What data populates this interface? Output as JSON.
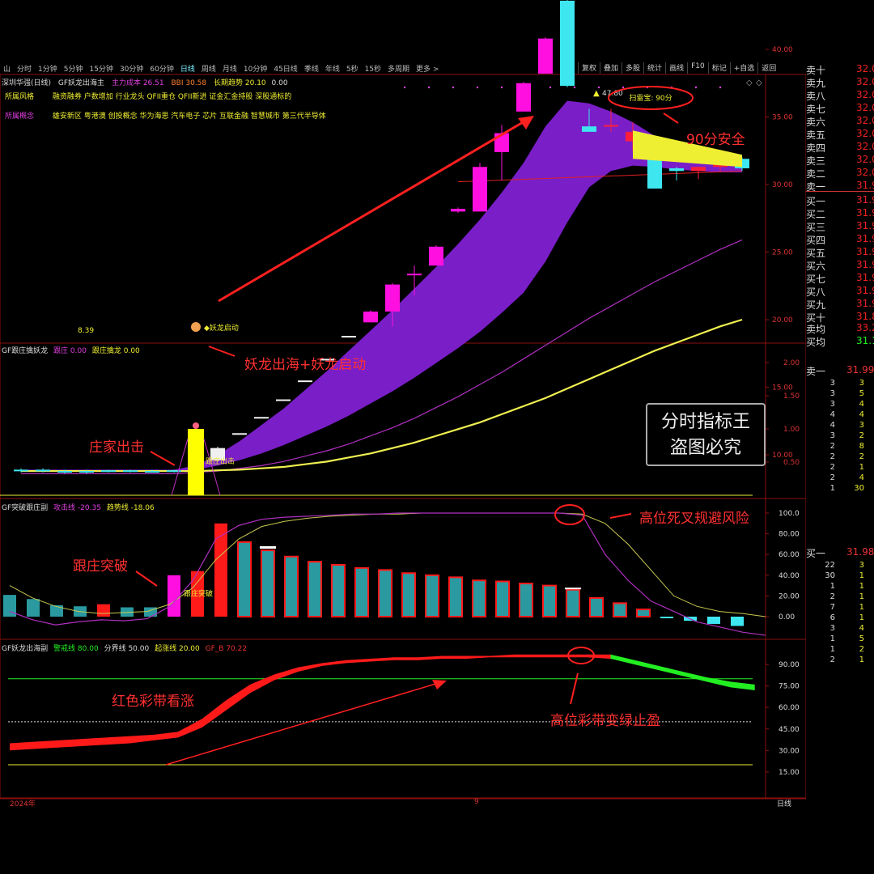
{
  "toolbar": {
    "items": [
      "山",
      "分时",
      "1分钟",
      "5分钟",
      "15分钟",
      "30分钟",
      "60分钟",
      "日线",
      "周线",
      "月线",
      "10分钟",
      "45日线",
      "季线",
      "年线",
      "5秒",
      "15秒",
      "多周期",
      "更多 >"
    ],
    "right_items": [
      "复权",
      "叠加",
      "多股",
      "统计",
      "画线",
      "F10",
      "标记",
      "+自选",
      "返回"
    ]
  },
  "main_header": {
    "stock": "深圳华强(日线)",
    "indicator": "GF妖龙出海主",
    "cost_label": "主力成本",
    "cost_value": "26.51",
    "bbi_label": "BBI",
    "bbi_value": "30.58",
    "trend_label": "长期趋势",
    "trend_value": "20.10",
    "extra_value": "0.00"
  },
  "info": {
    "style_label": "所属风格",
    "style_text": "融资融券 户数增加 行业龙头 QFII重仓 QFII新进 证金汇金持股 深股通标的",
    "concept_label": "所属概念",
    "concept_text": "雄安新区 粤港澳 创投概念 华为海思 汽车电子 芯片 互联金融 智慧城市 第三代半导体"
  },
  "main_chart": {
    "y_ticks": [
      "40.00",
      "35.00",
      "30.00",
      "25.00",
      "20.00",
      "15.00",
      "10.00"
    ],
    "y_values": [
      40,
      35,
      30,
      25,
      20,
      15,
      10
    ],
    "candles": [
      {
        "o": 8.8,
        "h": 9.0,
        "l": 8.7,
        "c": 8.9
      },
      {
        "o": 8.9,
        "h": 9.0,
        "l": 8.7,
        "c": 8.8
      },
      {
        "o": 8.8,
        "h": 8.9,
        "l": 8.6,
        "c": 8.75
      },
      {
        "o": 8.7,
        "h": 8.9,
        "l": 8.6,
        "c": 8.8
      },
      {
        "o": 8.8,
        "h": 8.9,
        "l": 8.7,
        "c": 8.85
      },
      {
        "o": 8.85,
        "h": 8.9,
        "l": 8.7,
        "c": 8.8
      },
      {
        "o": 8.8,
        "h": 8.9,
        "l": 8.7,
        "c": 8.75
      },
      {
        "o": 8.75,
        "h": 8.9,
        "l": 8.7,
        "c": 8.85
      },
      {
        "o": 8.6,
        "h": 10.0,
        "l": 8.4,
        "c": 9.6
      },
      {
        "o": 9.6,
        "h": 10.6,
        "l": 9.6,
        "c": 10.5
      },
      {
        "o": 11.6,
        "h": 11.6,
        "l": 11.6,
        "c": 11.6
      },
      {
        "o": 12.8,
        "h": 12.8,
        "l": 12.8,
        "c": 12.8
      },
      {
        "o": 14.1,
        "h": 14.1,
        "l": 14.1,
        "c": 14.1
      },
      {
        "o": 15.5,
        "h": 15.5,
        "l": 15.5,
        "c": 15.5
      },
      {
        "o": 17.1,
        "h": 17.1,
        "l": 17.1,
        "c": 17.1
      },
      {
        "o": 18.8,
        "h": 18.8,
        "l": 18.8,
        "c": 18.8
      },
      {
        "o": 19.8,
        "h": 20.7,
        "l": 19.8,
        "c": 20.6
      },
      {
        "o": 20.6,
        "h": 22.7,
        "l": 19.5,
        "c": 22.6
      },
      {
        "o": 23.4,
        "h": 24.0,
        "l": 21.8,
        "c": 23.4
      },
      {
        "o": 24.0,
        "h": 25.5,
        "l": 24.0,
        "c": 25.4
      },
      {
        "o": 28.0,
        "h": 28.3,
        "l": 27.9,
        "c": 28.2
      },
      {
        "o": 28.0,
        "h": 31.6,
        "l": 28.0,
        "c": 31.3
      },
      {
        "o": 32.4,
        "h": 34.4,
        "l": 30.3,
        "c": 33.8
      },
      {
        "o": 35.4,
        "h": 37.6,
        "l": 35.4,
        "c": 37.5
      },
      {
        "o": 38.2,
        "h": 40.9,
        "l": 38.2,
        "c": 40.8
      },
      {
        "o": 43.6,
        "h": 43.8,
        "l": 37.2,
        "c": 37.3
      },
      {
        "o": 34.3,
        "h": 35.6,
        "l": 33.9,
        "c": 33.9
      },
      {
        "o": 34.3,
        "h": 35.6,
        "l": 33.9,
        "c": 34.4
      },
      {
        "o": 33.2,
        "h": 34.6,
        "l": 32.5,
        "c": 33.9
      },
      {
        "o": 32.8,
        "h": 33.1,
        "l": 29.7,
        "c": 29.7
      },
      {
        "o": 31.2,
        "h": 31.3,
        "l": 30.3,
        "c": 31.0
      },
      {
        "o": 31.0,
        "h": 31.3,
        "l": 30.4,
        "c": 31.3
      },
      {
        "o": 31.3,
        "h": 32.0,
        "l": 31.0,
        "c": 31.6
      },
      {
        "o": 31.9,
        "h": 32.0,
        "l": 31.0,
        "c": 31.2
      }
    ],
    "band_upper": [
      8.9,
      8.9,
      8.9,
      8.9,
      8.9,
      8.9,
      8.9,
      8.9,
      9.2,
      10.0,
      11.0,
      12.2,
      13.4,
      14.8,
      16.2,
      17.7,
      19.2,
      20.7,
      22.3,
      23.9,
      25.6,
      27.4,
      29.4,
      31.6,
      34.3,
      36.2,
      36.0,
      35.4,
      34.6,
      33.6,
      32.9,
      32.3,
      31.9,
      31.6
    ],
    "band_lower": [
      8.8,
      8.8,
      8.8,
      8.8,
      8.8,
      8.8,
      8.8,
      8.8,
      8.9,
      9.2,
      9.6,
      10.1,
      10.7,
      11.4,
      12.1,
      12.9,
      13.8,
      14.7,
      15.7,
      16.8,
      17.9,
      19.1,
      20.5,
      22.0,
      24.3,
      27.2,
      29.8,
      31.0,
      31.4,
      31.3,
      31.1,
      31.0,
      30.9,
      30.9
    ],
    "ma_purple": [
      8.6,
      8.6,
      8.6,
      8.6,
      8.6,
      8.6,
      8.6,
      8.6,
      8.7,
      8.8,
      9.0,
      9.2,
      9.5,
      9.9,
      10.3,
      10.8,
      11.4,
      12.0,
      12.7,
      13.5,
      14.3,
      15.2,
      16.1,
      17.1,
      18.1,
      19.1,
      20.1,
      21.0,
      21.9,
      22.8,
      23.6,
      24.4,
      25.2,
      25.9
    ],
    "ma_yellow": [
      8.8,
      8.8,
      8.8,
      8.8,
      8.8,
      8.8,
      8.8,
      8.8,
      8.8,
      8.85,
      8.9,
      9.0,
      9.1,
      9.3,
      9.5,
      9.8,
      10.1,
      10.5,
      10.9,
      11.4,
      11.9,
      12.4,
      13.0,
      13.6,
      14.2,
      14.9,
      15.6,
      16.3,
      17.0,
      17.7,
      18.3,
      18.9,
      19.5,
      20.0
    ],
    "price_low": "8.39",
    "price_high": "47.80",
    "low_signal": "妖龙启动",
    "safety_badge": "扫雷宝: 90分"
  },
  "panel2": {
    "header_name": "GF跟庄擒妖龙",
    "l1": "跟庄",
    "v1": "0.00",
    "l2": "跟庄擒龙",
    "v2": "0.00",
    "y_ticks": [
      "2.00",
      "1.50",
      "1.00",
      "0.50"
    ],
    "y_values": [
      2.0,
      1.5,
      1.0,
      0.5
    ],
    "signal_index": 8,
    "signal_value": 1.0,
    "signal_text": "跟庄出击"
  },
  "panel3": {
    "header_name": "GF突破跟庄副",
    "l1": "攻击线",
    "v1": "-20.35",
    "l2": "趋势线",
    "v2": "-18.06",
    "y_ticks": [
      "100.0",
      "80.00",
      "60.00",
      "40.00",
      "20.00",
      "0.00"
    ],
    "y_values": [
      100,
      80,
      60,
      40,
      20,
      0
    ],
    "bars": [
      21,
      17,
      11,
      10,
      12,
      9,
      9,
      40,
      44,
      90,
      72,
      64,
      58,
      53,
      50,
      47,
      45,
      42,
      40,
      38,
      35,
      34,
      32,
      30,
      26,
      18,
      13,
      7,
      -1,
      -4,
      -7,
      -9
    ],
    "line_yellow": [
      30,
      18,
      10,
      5,
      3,
      4,
      5,
      12,
      28,
      55,
      75,
      87,
      92,
      95,
      97,
      98,
      99,
      99,
      100,
      100,
      100,
      100,
      100,
      100,
      100,
      99,
      90,
      70,
      45,
      20,
      10,
      5,
      3,
      0
    ],
    "line_purple": [
      5,
      -3,
      -8,
      -5,
      -3,
      -4,
      -2,
      10,
      35,
      75,
      88,
      94,
      96,
      97,
      98,
      99,
      99,
      100,
      100,
      100,
      100,
      100,
      100,
      100,
      100,
      98,
      60,
      35,
      15,
      5,
      -5,
      -10,
      -15,
      -18
    ],
    "signal_text": "跟庄突破"
  },
  "panel4": {
    "header_name": "GF妖龙出海副",
    "l1": "警戒线",
    "v1": "80.00",
    "l2": "分界线",
    "v2": "50.00",
    "l3": "起涨线",
    "v3": "20.00",
    "l4": "GF_B",
    "v4": "70.22",
    "y_ticks": [
      "90.00",
      "75.00",
      "60.00",
      "45.00",
      "30.00",
      "15.00"
    ],
    "y_values": [
      90,
      75,
      60,
      45,
      30,
      15
    ],
    "band_upper": [
      35,
      36,
      37,
      38,
      39,
      40,
      41,
      43,
      52,
      65,
      76,
      83,
      88,
      91,
      93,
      94,
      95,
      95,
      96,
      96,
      96,
      97,
      97,
      97,
      97,
      97,
      93,
      89,
      85,
      81,
      78,
      76
    ],
    "band_lower": [
      30,
      31,
      32,
      33,
      34,
      35,
      37,
      39,
      46,
      58,
      70,
      79,
      85,
      89,
      91,
      92,
      93,
      93,
      94,
      94,
      95,
      95,
      95,
      95,
      95,
      94,
      90,
      86,
      82,
      78,
      74,
      72
    ],
    "cross_line": [
      20,
      22,
      25,
      29,
      33,
      38,
      43,
      48,
      54,
      60,
      65,
      70,
      74,
      78,
      81,
      84,
      86
    ]
  },
  "axis": {
    "left": "2024年",
    "mid": "9",
    "right": "日线"
  },
  "annotations": {
    "safe": "90分安全",
    "breakout": "妖龙出海+妖龙启动",
    "zhuangjia": "庄家出击",
    "genzhuang": "跟庄突破",
    "deadcross": "高位死叉规避风险",
    "redband": "红色彩带看涨",
    "greenband": "高位彩带变绿止盈"
  },
  "orderbook": {
    "sells": [
      {
        "label": "卖十",
        "price": "32.0"
      },
      {
        "label": "卖九",
        "price": "32.0"
      },
      {
        "label": "卖八",
        "price": "32.0"
      },
      {
        "label": "卖七",
        "price": "32.0"
      },
      {
        "label": "卖六",
        "price": "32.0"
      },
      {
        "label": "卖五",
        "price": "32.0"
      },
      {
        "label": "卖四",
        "price": "32.0"
      },
      {
        "label": "卖三",
        "price": "32.0"
      },
      {
        "label": "卖二",
        "price": "32.0"
      },
      {
        "label": "卖一",
        "price": "31.9"
      }
    ],
    "buys": [
      {
        "label": "买一",
        "price": "31.9"
      },
      {
        "label": "买二",
        "price": "31.9"
      },
      {
        "label": "买三",
        "price": "31.9"
      },
      {
        "label": "买四",
        "price": "31.9"
      },
      {
        "label": "买五",
        "price": "31.9"
      },
      {
        "label": "买六",
        "price": "31.9"
      },
      {
        "label": "买七",
        "price": "31.9"
      },
      {
        "label": "买八",
        "price": "31.9"
      },
      {
        "label": "买九",
        "price": "31.9"
      },
      {
        "label": "买十",
        "price": "31.8"
      }
    ],
    "avg_sell_label": "卖均",
    "avg_sell": "33.2",
    "avg_buy_label": "买均",
    "avg_buy": "31.1",
    "sell1_label": "卖一",
    "sell1_price": "31.99",
    "sell1_ticks": [
      [
        "3",
        "3"
      ],
      [
        "3",
        "5"
      ],
      [
        "3",
        "4"
      ],
      [
        "4",
        "4"
      ],
      [
        "4",
        "3"
      ],
      [
        "3",
        "2"
      ],
      [
        "2",
        "8"
      ],
      [
        "2",
        "2"
      ],
      [
        "2",
        "1"
      ],
      [
        "2",
        "4"
      ],
      [
        "1",
        "30"
      ]
    ],
    "buy1_label": "买一",
    "buy1_price": "31.98",
    "buy1_ticks": [
      [
        "22",
        "3"
      ],
      [
        "30",
        "1"
      ],
      [
        "1",
        "1"
      ],
      [
        "2",
        "1"
      ],
      [
        "7",
        "1"
      ],
      [
        "6",
        "1"
      ],
      [
        "3",
        "4"
      ],
      [
        "1",
        "5"
      ],
      [
        "1",
        "2"
      ],
      [
        "2",
        "1"
      ]
    ]
  },
  "watermark": {
    "line1": "分时指标王",
    "line2": "盗图必究"
  },
  "colors": {
    "up": "#ff1e3c",
    "down": "#3ee6f0",
    "band_purple": "#7a1ec8",
    "ma_yellow": "#f0f050",
    "ma_purple": "#b030c0",
    "red_band": "#ff1a1a",
    "green_band": "#22ee22",
    "annotation": "#ff3030"
  }
}
